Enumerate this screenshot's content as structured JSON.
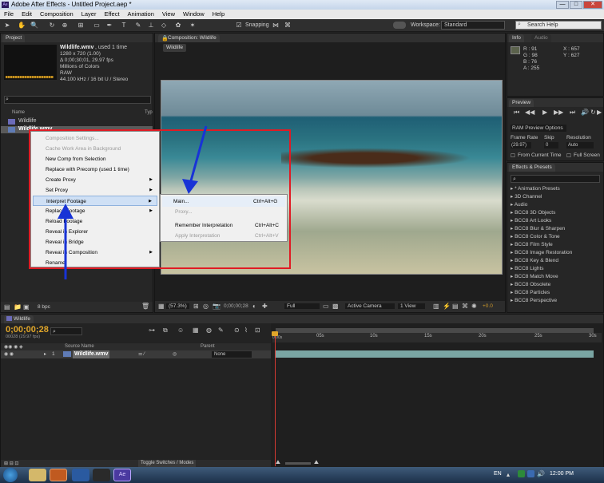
{
  "window": {
    "title": "Adobe After Effects - Untitled Project.aep *",
    "minimize": "—",
    "maximize": "□",
    "close": "✕"
  },
  "menubar": [
    "File",
    "Edit",
    "Composition",
    "Layer",
    "Effect",
    "Animation",
    "View",
    "Window",
    "Help"
  ],
  "toolbar": {
    "snapping": "Snapping",
    "workspace_label": "Workspace:",
    "workspace_value": "Standard",
    "search_placeholder": "Search Help"
  },
  "project": {
    "tab": "Project",
    "file_name": "Wildlife.wmv",
    "used": ", used 1 time",
    "info": [
      "1280 x 720 (1.00)",
      "Δ 0;00;30;01, 29.97 fps",
      "Millions of Colors",
      "RAW",
      "44.100 kHz / 16 bit U / Stereo"
    ],
    "col_name": "Name",
    "col_type": "Typ",
    "items": [
      "Wildlife",
      "Wildlife.wmv"
    ],
    "bpc": "8 bpc"
  },
  "comp": {
    "tab": "Composition: Wildlife",
    "subtab": "Wildlife",
    "zoom": "(57.3%)",
    "timecode": "0;00;00;28",
    "resolution": "Full",
    "camera": "Active Camera",
    "views": "1 View",
    "exposure": "+0.0"
  },
  "context_menu": {
    "items": [
      {
        "label": "Composition Settings...",
        "disabled": true
      },
      {
        "label": "Cache Work Area in Background",
        "disabled": true
      },
      {
        "label": "New Comp from Selection",
        "disabled": false
      },
      {
        "label": "Replace with Precomp (used 1 time)",
        "disabled": false
      },
      {
        "label": "Create Proxy",
        "disabled": false,
        "sub": true
      },
      {
        "label": "Set Proxy",
        "disabled": false,
        "sub": true
      },
      {
        "label": "Interpret Footage",
        "disabled": false,
        "sub": true
      },
      {
        "label": "Replace Footage",
        "disabled": false,
        "sub": true
      },
      {
        "label": "Reload Footage",
        "disabled": false
      },
      {
        "label": "Reveal in Explorer",
        "disabled": false
      },
      {
        "label": "Reveal in Bridge",
        "disabled": false
      },
      {
        "label": "Reveal in Composition",
        "disabled": false,
        "sub": true
      },
      {
        "label": "Rename",
        "disabled": false
      }
    ]
  },
  "submenu": {
    "items": [
      {
        "label": "Main...",
        "shortcut": "Ctrl+Alt+G",
        "disabled": false
      },
      {
        "label": "Proxy...",
        "shortcut": "",
        "disabled": true
      },
      {
        "label": "Remember Interpretation",
        "shortcut": "Ctrl+Alt+C",
        "disabled": false
      },
      {
        "label": "Apply Interpretation",
        "shortcut": "Ctrl+Alt+V",
        "disabled": true
      }
    ]
  },
  "info": {
    "tab": "Info",
    "tab2": "Audio",
    "r": "R : 91",
    "g": "G : 98",
    "b": "B : 76",
    "a": "A : 255",
    "x": "X : 657",
    "y": "Y : 627"
  },
  "preview": {
    "tab": "Preview",
    "ram": "RAM Preview Options",
    "frame_rate_label": "Frame Rate",
    "skip_label": "Skip",
    "resolution_label": "Resolution",
    "frame_rate": "(29.97)",
    "skip": "0",
    "resolution": "Auto",
    "from_current": "From Current Time",
    "full_screen": "Full Screen"
  },
  "effects": {
    "tab": "Effects & Presets",
    "items": [
      "* Animation Presets",
      "3D Channel",
      "Audio",
      "BCC8 3D Objects",
      "BCC8 Art Looks",
      "BCC8 Blur & Sharpen",
      "BCC8 Color & Tone",
      "BCC8 Film Style",
      "BCC8 Image Restoration",
      "BCC8 Key & Blend",
      "BCC8 Lights",
      "BCC8 Match Move",
      "BCC8 Obsolete",
      "BCC8 Particles",
      "BCC8 Perspective"
    ]
  },
  "timeline": {
    "tab": "Wildlife",
    "timecode": "0;00;00;28",
    "frames": "00028 (29.97 fps)",
    "col_source": "Source Name",
    "col_parent": "Parent",
    "layer_num": "1",
    "layer_name": "Wildlife.wmv",
    "parent": "None",
    "ruler": [
      "0s",
      "05s",
      "10s",
      "15s",
      "20s",
      "25s",
      "30s"
    ],
    "ruler_start": "0:00s",
    "toggle": "Toggle Switches / Modes"
  },
  "taskbar": {
    "lang": "EN",
    "time": "12:00 PM",
    "ae_label": "Ae"
  }
}
